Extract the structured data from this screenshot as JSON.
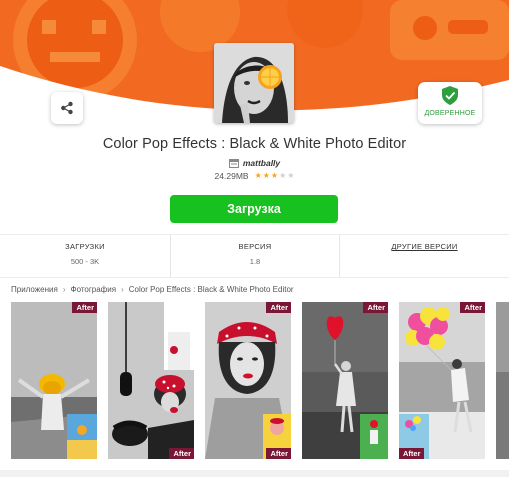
{
  "header": {
    "share_icon": "share-icon",
    "app_icon": "app-icon-image",
    "verified_icon": "shield-check-icon",
    "verified_label": "ДОВЕРЕННОЕ"
  },
  "app": {
    "title": "Color Pop Effects : Black & White Photo Editor",
    "developer": "mattbally",
    "size": "24.29MB",
    "rating": 3,
    "rating_max": 5
  },
  "download": {
    "label": "Загрузка"
  },
  "stats": {
    "downloads_label": "ЗАГРУЗКИ",
    "downloads_value": "500 - 3K",
    "version_label": "ВЕРСИЯ",
    "version_value": "1.8",
    "other_versions_label": "ДРУГИЕ ВЕРСИИ"
  },
  "breadcrumb": {
    "items": [
      "Приложения",
      "Фотография",
      "Color Pop Effects : Black & White Photo Editor"
    ]
  },
  "screenshots": {
    "tags": [
      "After",
      "After",
      "After",
      "After",
      "After",
      "After",
      "After"
    ]
  },
  "colors": {
    "banner_orange": "#f26a22",
    "download_green": "#17c11f",
    "verified_green": "#2f9e3e",
    "after_tag": "#7a1736",
    "star_on": "#f5a623"
  }
}
